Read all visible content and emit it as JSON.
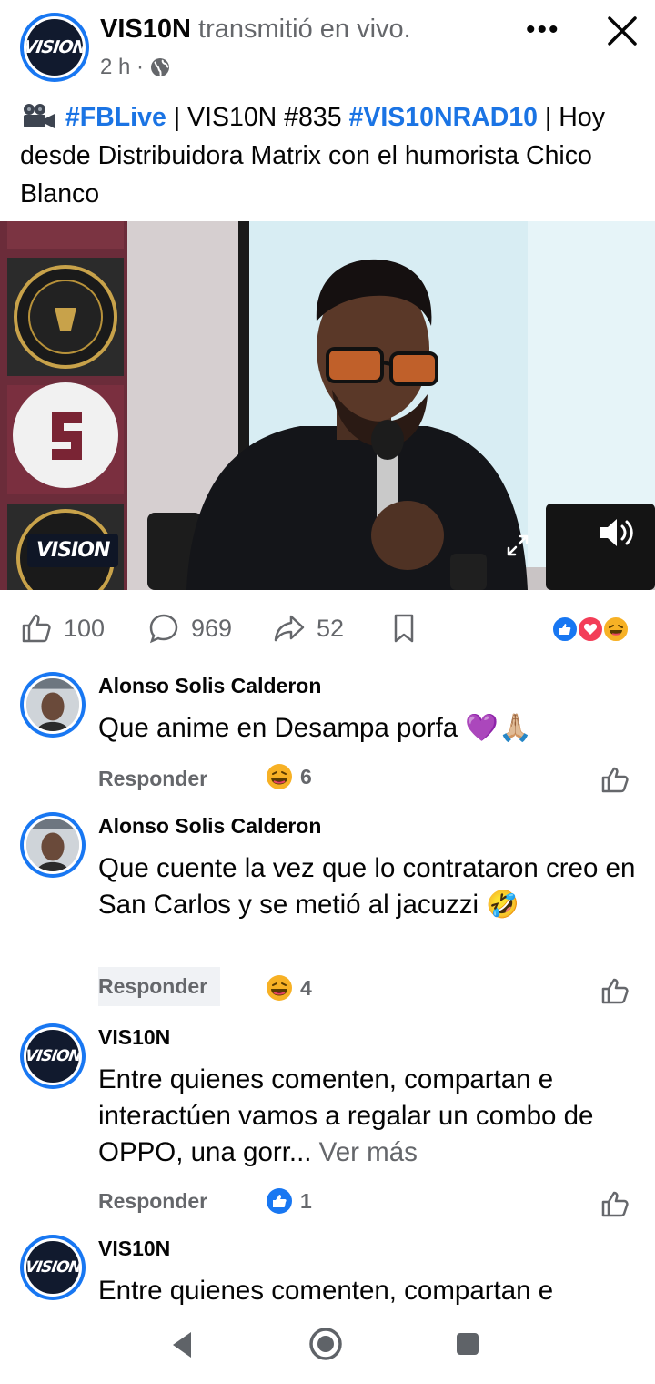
{
  "header": {
    "page_name": "VIS10N",
    "action_text": "transmitió en vivo.",
    "time": "2 h ·",
    "avatar_logo": "VISION"
  },
  "post": {
    "caption_tag1": "#FBLive",
    "caption_mid": " | VIS10N #835 ",
    "caption_tag2": "#VIS10NRAD10",
    "caption_rest": " | Hoy desde Distribuidora Matrix con el humorista Chico Blanco",
    "video_logo": "VISION"
  },
  "stats": {
    "likes": "100",
    "comments": "969",
    "shares": "52"
  },
  "comments": [
    {
      "name": "Alonso Solis Calderon",
      "text": "Que anime en Desampa porfa 💜🙏🏼",
      "reply_label": "Responder",
      "reaction_count": "6",
      "reaction_icon": "grinning-emoji-icon"
    },
    {
      "name": "Alonso Solis Calderon",
      "text": "Que cuente la vez que lo contrataron creo en San Carlos y se metió al jacuzzi 🤣",
      "reply_label": "Responder",
      "reaction_count": "4",
      "reaction_icon": "grinning-emoji-icon"
    },
    {
      "name": "VIS10N",
      "text": "Entre quienes comenten, compartan e interactúen vamos a regalar un combo de OPPO, una gorr...",
      "see_more": " Ver más",
      "reply_label": "Responder",
      "reaction_count": "1",
      "reaction_icon": "like-icon"
    },
    {
      "name": "VIS10N",
      "text": "Entre quienes comenten, compartan e"
    }
  ],
  "colors": {
    "brand_blue": "#1877f2",
    "hashtag_blue": "#1b74e4",
    "secondary_text": "#65676b"
  }
}
